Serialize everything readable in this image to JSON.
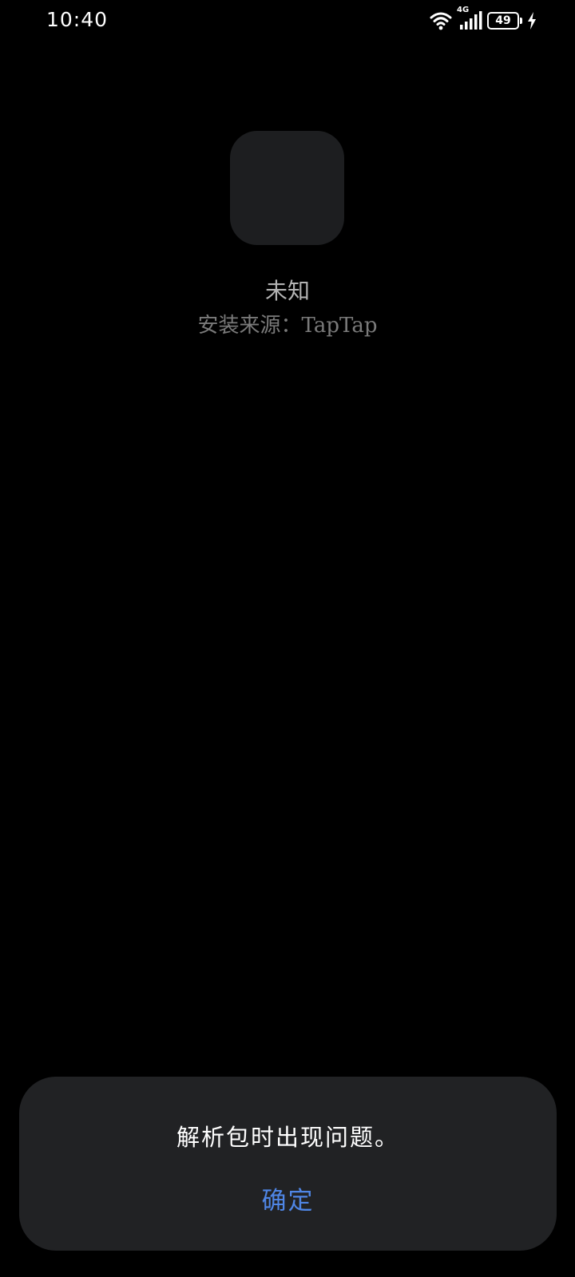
{
  "status_bar": {
    "time": "10:40",
    "network": "4G",
    "battery_level": "49",
    "icons": [
      "wifi-icon",
      "signal-icon",
      "battery-icon",
      "charging-icon"
    ]
  },
  "app": {
    "name": "未知",
    "install_source": "安装来源：TapTap"
  },
  "dialog": {
    "message": "解析包时出现问题。",
    "confirm_label": "确定"
  },
  "colors": {
    "background": "#000000",
    "dialog_background": "#212224",
    "icon_placeholder": "#1d1e20",
    "accent": "#4f86e6"
  }
}
